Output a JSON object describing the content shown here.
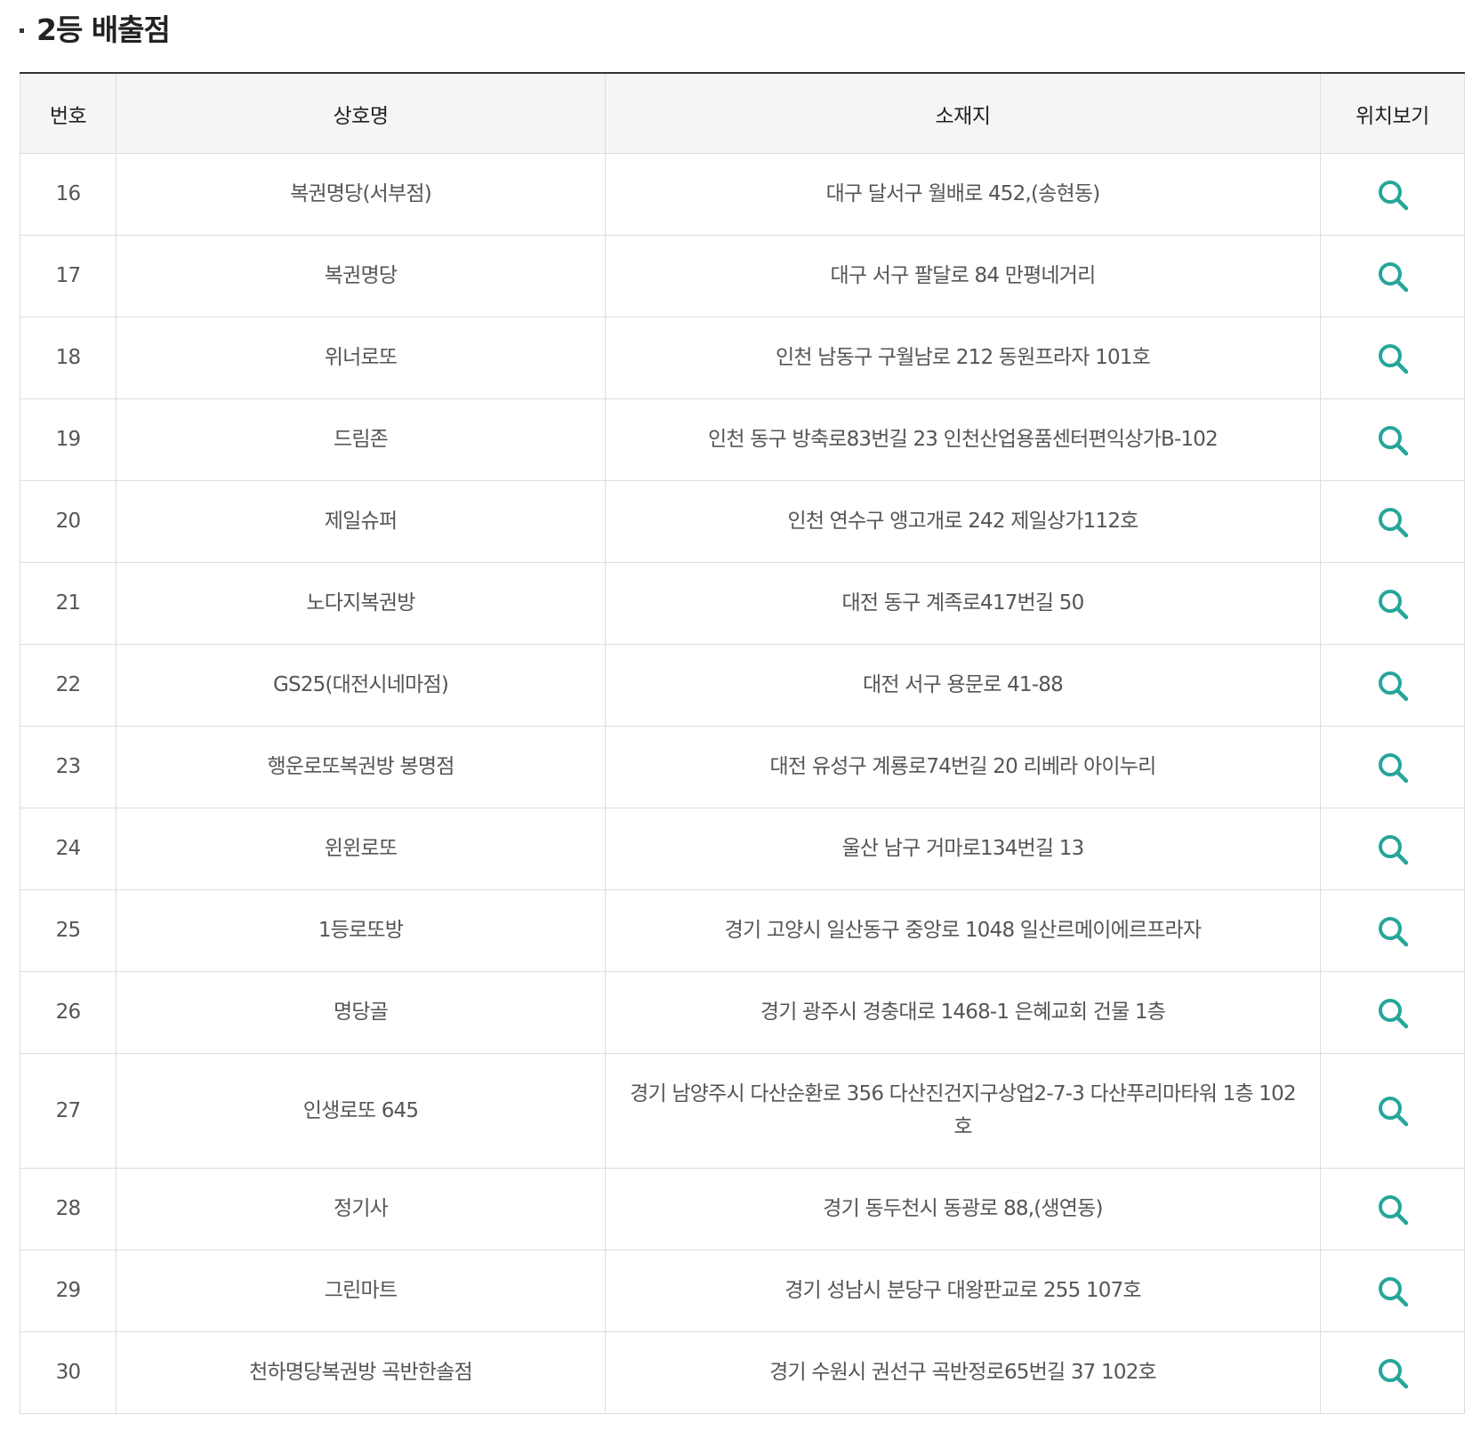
{
  "section": {
    "title": "2등 배출점"
  },
  "table": {
    "headers": {
      "no": "번호",
      "name": "상호명",
      "address": "소재지",
      "location": "위치보기"
    },
    "rows": [
      {
        "no": "16",
        "name": "복권명당(서부점)",
        "address": "대구 달서구 월배로 452,(송현동)"
      },
      {
        "no": "17",
        "name": "복권명당",
        "address": "대구 서구 팔달로 84 만평네거리"
      },
      {
        "no": "18",
        "name": "위너로또",
        "address": "인천 남동구 구월남로 212 동원프라자 101호"
      },
      {
        "no": "19",
        "name": "드림존",
        "address": "인천 동구 방축로83번길 23 인천산업용품센터편익상가B-102"
      },
      {
        "no": "20",
        "name": "제일슈퍼",
        "address": "인천 연수구 앵고개로 242 제일상가112호"
      },
      {
        "no": "21",
        "name": "노다지복권방",
        "address": "대전 동구 계족로417번길 50"
      },
      {
        "no": "22",
        "name": "GS25(대전시네마점)",
        "address": "대전 서구 용문로 41-88"
      },
      {
        "no": "23",
        "name": "행운로또복권방 봉명점",
        "address": "대전 유성구 계룡로74번길 20 리베라 아이누리"
      },
      {
        "no": "24",
        "name": "윈윈로또",
        "address": "울산 남구 거마로134번길 13"
      },
      {
        "no": "25",
        "name": "1등로또방",
        "address": "경기 고양시 일산동구 중앙로 1048 일산르메이에르프라자"
      },
      {
        "no": "26",
        "name": "명당골",
        "address": "경기 광주시 경충대로 1468-1 은혜교회 건물 1층"
      },
      {
        "no": "27",
        "name": "인생로또 645",
        "address": "경기 남양주시 다산순환로 356 다산진건지구상업2-7-3 다산푸리마타워 1층 102호"
      },
      {
        "no": "28",
        "name": "정기사",
        "address": "경기 동두천시 동광로 88,(생연동)"
      },
      {
        "no": "29",
        "name": "그린마트",
        "address": "경기 성남시 분당구 대왕판교로 255 107호"
      },
      {
        "no": "30",
        "name": "천하명당복권방 곡반한솔점",
        "address": "경기 수원시 권선구 곡반정로65번길 37 102호"
      }
    ]
  },
  "icons": {
    "location": "search-icon"
  },
  "colors": {
    "icon": "#26a69a",
    "header_bg": "#f5f5f5",
    "border": "#dddddd",
    "top_border": "#333333"
  }
}
